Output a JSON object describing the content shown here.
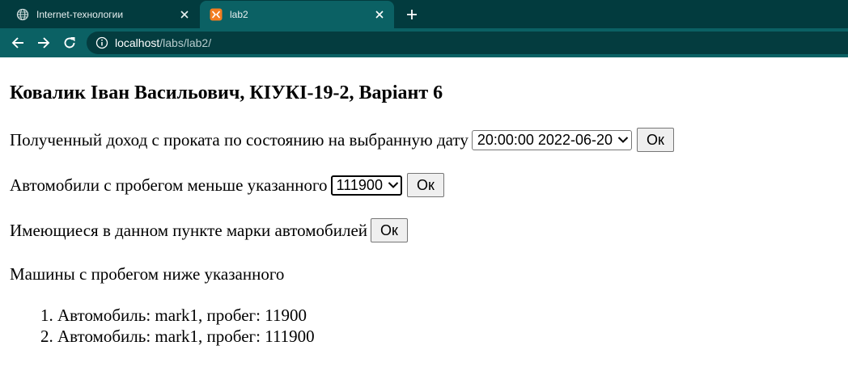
{
  "browser": {
    "tabs": [
      {
        "title": "Internet-технологии",
        "icon": "globe-icon",
        "active": false
      },
      {
        "title": "lab2",
        "icon": "xampp-icon",
        "active": true
      }
    ],
    "address": {
      "host": "localhost",
      "path": "/labs/lab2/"
    }
  },
  "page": {
    "heading": "Ковалик Іван Васильович, КІУКІ-19-2, Варіант 6",
    "income": {
      "label": "Полученный доход с проката по состоянию на выбранную дату",
      "selected": "20:00:00 2022-06-20",
      "button": "Ок"
    },
    "mileage": {
      "label": "Автомобили с пробегом меньше указанного",
      "selected": "111900",
      "button": "Ок"
    },
    "brands": {
      "label": "Имеющиеся в данном пункте марки автомобилей",
      "button": "Ок"
    },
    "results": {
      "title": "Машины с пробегом ниже указанного",
      "items": [
        "Автомобиль: mark1, пробег: 11900",
        "Автомобиль: mark1, пробег: 111900"
      ]
    }
  },
  "colors": {
    "tabbar": "#023b3e",
    "toolbar": "#0b6164",
    "omnibox": "#043c3f",
    "xampp_orange": "#f37d21"
  }
}
